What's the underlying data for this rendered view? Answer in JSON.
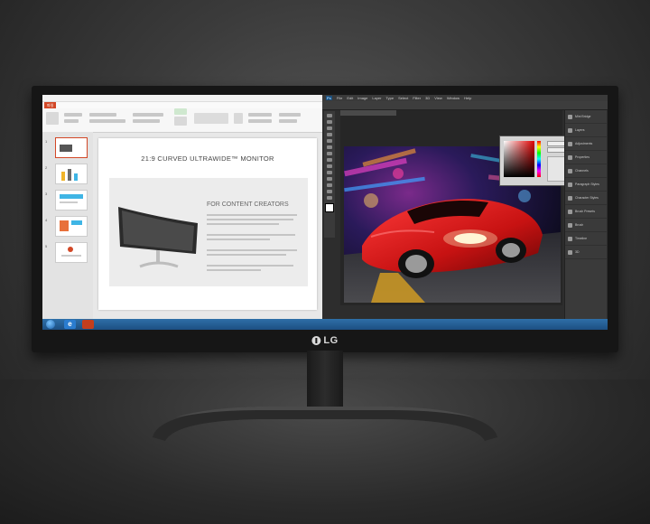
{
  "brand": {
    "logo_text": "LG"
  },
  "powerpoint": {
    "file_tab": "파일",
    "slide_title": "21:9 CURVED ULTRAWIDE™ MONITOR",
    "slide_heading": "FOR CONTENT CREATORS",
    "thumbnail_numbers": [
      "1",
      "2",
      "3",
      "4",
      "5"
    ]
  },
  "photoshop": {
    "app_badge": "Ps",
    "menu": [
      "File",
      "Edit",
      "Image",
      "Layer",
      "Type",
      "Select",
      "Filter",
      "3D",
      "View",
      "Window",
      "Help"
    ],
    "panels": [
      "Mini Bridge",
      "Layers",
      "Adjustments",
      "Properties",
      "Channels",
      "Paragraph Styles",
      "Character Styles",
      "Brush Presets",
      "Brush",
      "Timeline",
      "3D"
    ]
  },
  "colors": {
    "ppt_accent": "#d24726",
    "ps_accent": "#1c4f7c",
    "car_red": "#d11b1b",
    "taskbar": "#2e6fa8"
  },
  "icons": [
    "windows-start-icon",
    "internet-explorer-icon",
    "powerpoint-icon"
  ]
}
